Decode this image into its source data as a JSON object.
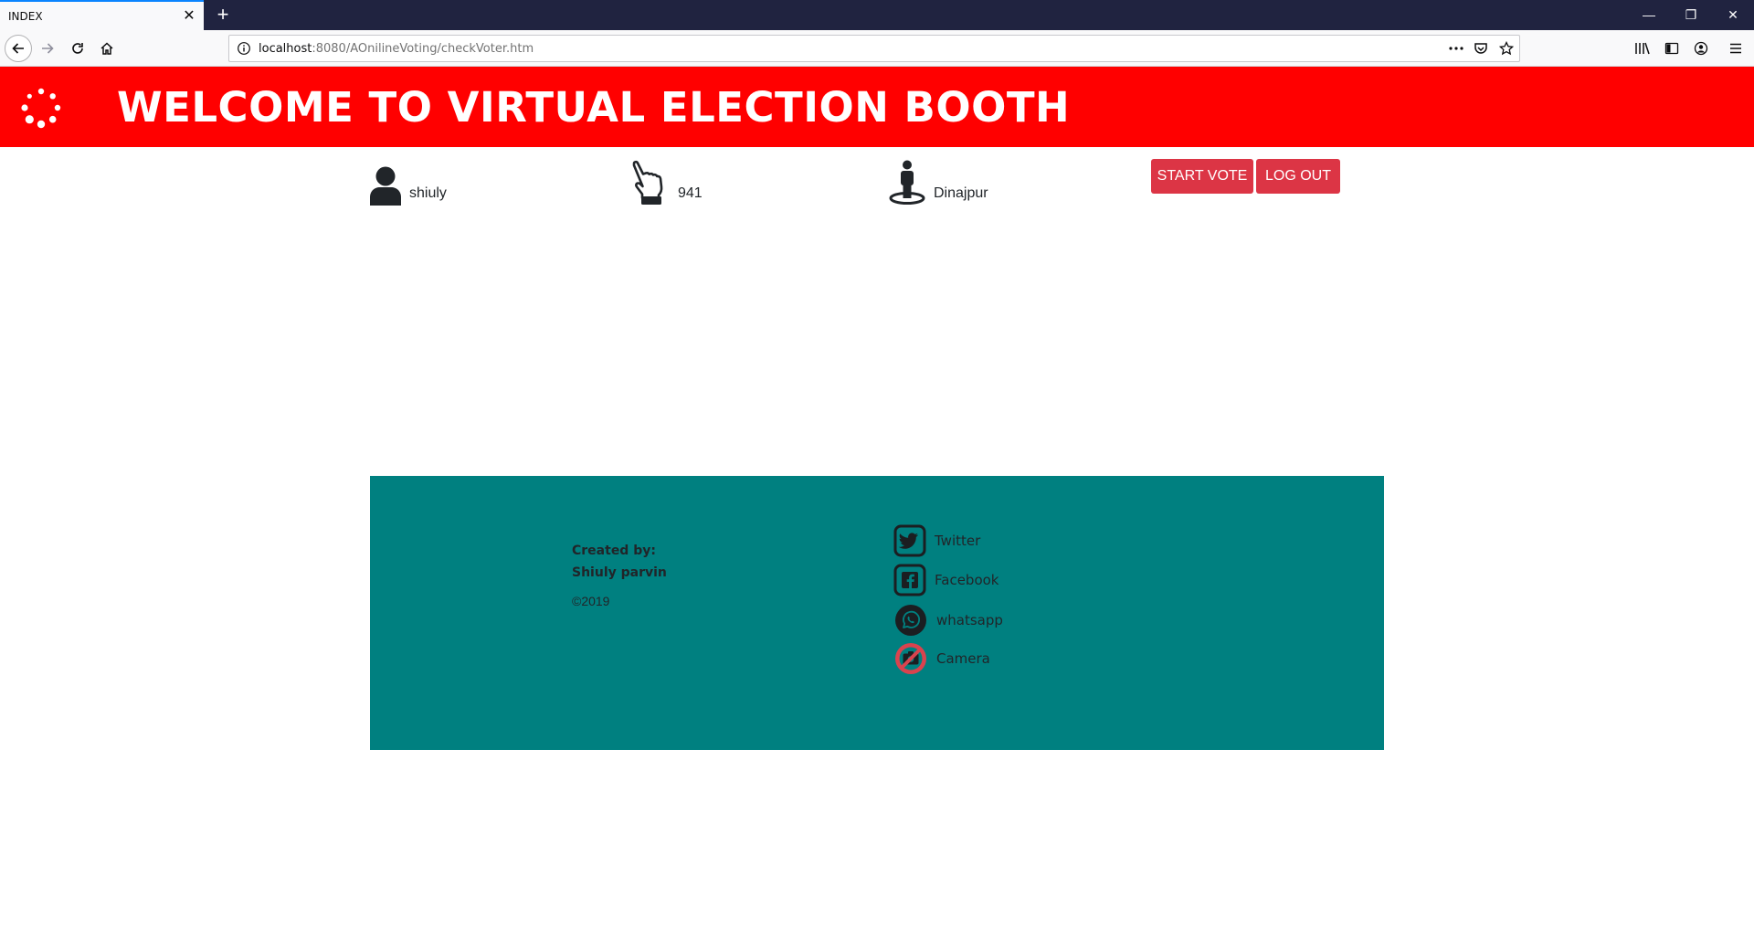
{
  "browser": {
    "tab_title": "INDEX",
    "url_host": "localhost",
    "url_rest": ":8080/AOnilineVoting/checkVoter.htm"
  },
  "banner": {
    "title": "WELCOME TO VIRTUAL ELECTION BOOTH"
  },
  "voter": {
    "name": "shiuly",
    "id": "941",
    "location": "Dinajpur"
  },
  "actions": {
    "start_vote": "START VOTE",
    "log_out": "LOG OUT"
  },
  "footer": {
    "created_by_label": "Created by:",
    "author": "Shiuly parvin",
    "copyright": "©2019",
    "social": [
      {
        "label": "Twitter",
        "icon": "twitter-icon"
      },
      {
        "label": "Facebook",
        "icon": "facebook-icon"
      },
      {
        "label": "whatsapp",
        "icon": "whatsapp-icon"
      },
      {
        "label": "Camera",
        "icon": "camera-off-icon"
      }
    ]
  },
  "colors": {
    "banner": "#ff0000",
    "button": "#dc3545",
    "footer": "#008080"
  }
}
